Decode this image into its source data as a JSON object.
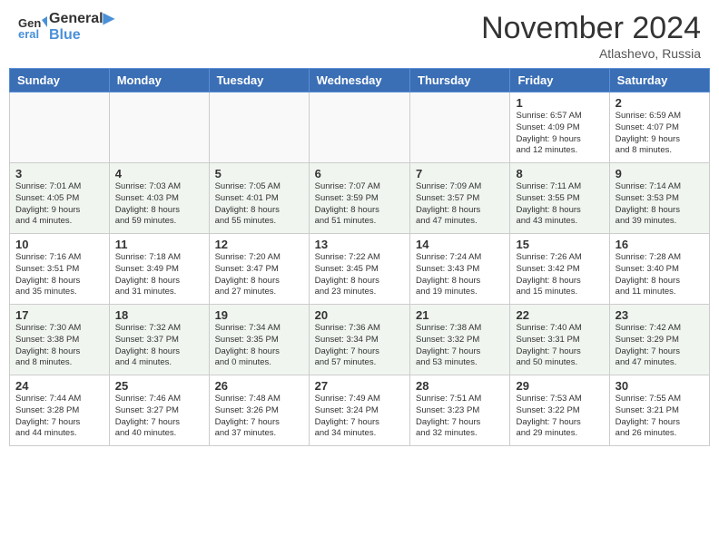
{
  "header": {
    "logo_line1": "General",
    "logo_line2": "Blue",
    "month": "November 2024",
    "location": "Atlashevo, Russia"
  },
  "weekdays": [
    "Sunday",
    "Monday",
    "Tuesday",
    "Wednesday",
    "Thursday",
    "Friday",
    "Saturday"
  ],
  "rows": [
    [
      {
        "day": "",
        "info": ""
      },
      {
        "day": "",
        "info": ""
      },
      {
        "day": "",
        "info": ""
      },
      {
        "day": "",
        "info": ""
      },
      {
        "day": "",
        "info": ""
      },
      {
        "day": "1",
        "info": "Sunrise: 6:57 AM\nSunset: 4:09 PM\nDaylight: 9 hours\nand 12 minutes."
      },
      {
        "day": "2",
        "info": "Sunrise: 6:59 AM\nSunset: 4:07 PM\nDaylight: 9 hours\nand 8 minutes."
      }
    ],
    [
      {
        "day": "3",
        "info": "Sunrise: 7:01 AM\nSunset: 4:05 PM\nDaylight: 9 hours\nand 4 minutes."
      },
      {
        "day": "4",
        "info": "Sunrise: 7:03 AM\nSunset: 4:03 PM\nDaylight: 8 hours\nand 59 minutes."
      },
      {
        "day": "5",
        "info": "Sunrise: 7:05 AM\nSunset: 4:01 PM\nDaylight: 8 hours\nand 55 minutes."
      },
      {
        "day": "6",
        "info": "Sunrise: 7:07 AM\nSunset: 3:59 PM\nDaylight: 8 hours\nand 51 minutes."
      },
      {
        "day": "7",
        "info": "Sunrise: 7:09 AM\nSunset: 3:57 PM\nDaylight: 8 hours\nand 47 minutes."
      },
      {
        "day": "8",
        "info": "Sunrise: 7:11 AM\nSunset: 3:55 PM\nDaylight: 8 hours\nand 43 minutes."
      },
      {
        "day": "9",
        "info": "Sunrise: 7:14 AM\nSunset: 3:53 PM\nDaylight: 8 hours\nand 39 minutes."
      }
    ],
    [
      {
        "day": "10",
        "info": "Sunrise: 7:16 AM\nSunset: 3:51 PM\nDaylight: 8 hours\nand 35 minutes."
      },
      {
        "day": "11",
        "info": "Sunrise: 7:18 AM\nSunset: 3:49 PM\nDaylight: 8 hours\nand 31 minutes."
      },
      {
        "day": "12",
        "info": "Sunrise: 7:20 AM\nSunset: 3:47 PM\nDaylight: 8 hours\nand 27 minutes."
      },
      {
        "day": "13",
        "info": "Sunrise: 7:22 AM\nSunset: 3:45 PM\nDaylight: 8 hours\nand 23 minutes."
      },
      {
        "day": "14",
        "info": "Sunrise: 7:24 AM\nSunset: 3:43 PM\nDaylight: 8 hours\nand 19 minutes."
      },
      {
        "day": "15",
        "info": "Sunrise: 7:26 AM\nSunset: 3:42 PM\nDaylight: 8 hours\nand 15 minutes."
      },
      {
        "day": "16",
        "info": "Sunrise: 7:28 AM\nSunset: 3:40 PM\nDaylight: 8 hours\nand 11 minutes."
      }
    ],
    [
      {
        "day": "17",
        "info": "Sunrise: 7:30 AM\nSunset: 3:38 PM\nDaylight: 8 hours\nand 8 minutes."
      },
      {
        "day": "18",
        "info": "Sunrise: 7:32 AM\nSunset: 3:37 PM\nDaylight: 8 hours\nand 4 minutes."
      },
      {
        "day": "19",
        "info": "Sunrise: 7:34 AM\nSunset: 3:35 PM\nDaylight: 8 hours\nand 0 minutes."
      },
      {
        "day": "20",
        "info": "Sunrise: 7:36 AM\nSunset: 3:34 PM\nDaylight: 7 hours\nand 57 minutes."
      },
      {
        "day": "21",
        "info": "Sunrise: 7:38 AM\nSunset: 3:32 PM\nDaylight: 7 hours\nand 53 minutes."
      },
      {
        "day": "22",
        "info": "Sunrise: 7:40 AM\nSunset: 3:31 PM\nDaylight: 7 hours\nand 50 minutes."
      },
      {
        "day": "23",
        "info": "Sunrise: 7:42 AM\nSunset: 3:29 PM\nDaylight: 7 hours\nand 47 minutes."
      }
    ],
    [
      {
        "day": "24",
        "info": "Sunrise: 7:44 AM\nSunset: 3:28 PM\nDaylight: 7 hours\nand 44 minutes."
      },
      {
        "day": "25",
        "info": "Sunrise: 7:46 AM\nSunset: 3:27 PM\nDaylight: 7 hours\nand 40 minutes."
      },
      {
        "day": "26",
        "info": "Sunrise: 7:48 AM\nSunset: 3:26 PM\nDaylight: 7 hours\nand 37 minutes."
      },
      {
        "day": "27",
        "info": "Sunrise: 7:49 AM\nSunset: 3:24 PM\nDaylight: 7 hours\nand 34 minutes."
      },
      {
        "day": "28",
        "info": "Sunrise: 7:51 AM\nSunset: 3:23 PM\nDaylight: 7 hours\nand 32 minutes."
      },
      {
        "day": "29",
        "info": "Sunrise: 7:53 AM\nSunset: 3:22 PM\nDaylight: 7 hours\nand 29 minutes."
      },
      {
        "day": "30",
        "info": "Sunrise: 7:55 AM\nSunset: 3:21 PM\nDaylight: 7 hours\nand 26 minutes."
      }
    ]
  ]
}
